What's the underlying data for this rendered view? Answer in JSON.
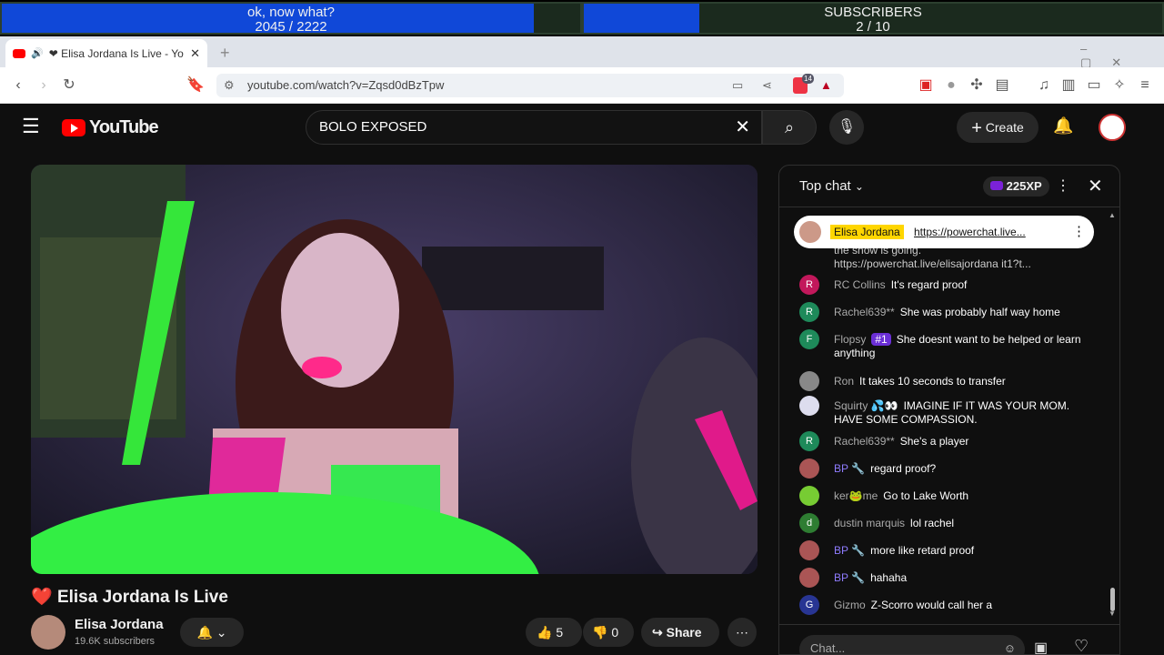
{
  "overlay": {
    "goal1": {
      "label": "ok, now what?",
      "current": "2045",
      "sep": "/",
      "total": "2222",
      "progress": 0.92
    },
    "goal2": {
      "label": "SUBSCRIBERS",
      "current": "2",
      "sep": "/",
      "total": "10",
      "progress": 0.2
    }
  },
  "browser": {
    "tab_title": "❤ Elisa Jordana Is Live - Yo",
    "url": "youtube.com/watch?v=Zqsd0dBzTpw",
    "brave_badge": "14"
  },
  "youtube": {
    "logo_text": "YouTube",
    "search_value": "BOLO EXPOSED",
    "create_label": "Create"
  },
  "video": {
    "title_heart": "❤️",
    "title": "Elisa Jordana Is Live",
    "channel": "Elisa Jordana",
    "subscribers": "19.6K subscribers",
    "likes": "5",
    "dislikes": "0",
    "share_label": "Share"
  },
  "chat": {
    "header": "Top chat",
    "xp": "225XP",
    "pinned": {
      "author": "Elisa Jordana",
      "text": "https://powerchat.live..."
    },
    "partial": "the show is going. https://powerchat.live/elisajordana it1?t...",
    "input_placeholder": "Chat...",
    "messages": [
      {
        "author": "RC Collins",
        "text": "It's regard proof",
        "avatar": "R",
        "color": "#c2185b"
      },
      {
        "author": "Rachel639**",
        "text": "She was probably half way home",
        "avatar": "R",
        "color": "#1e8a5a"
      },
      {
        "author": "Flopsy",
        "badge": "#1",
        "text": "She doesnt want to be helped or learn anything",
        "avatar": "F",
        "color": "#1e8a5a"
      },
      {
        "author": "Ron",
        "text": "It takes 10 seconds to transfer",
        "avatar": "",
        "color": "#888"
      },
      {
        "author": "Squirty 💦👀",
        "text": "IMAGINE IF IT WAS YOUR MOM. HAVE SOME COMPASSION.",
        "avatar": "",
        "color": "#dde"
      },
      {
        "author": "Rachel639**",
        "text": "She's a player",
        "avatar": "R",
        "color": "#1e8a5a"
      },
      {
        "author": "BP 🔧",
        "text": "regard proof?",
        "avatar": "",
        "color": "#a55",
        "mod": true
      },
      {
        "author": "ker🐸me",
        "text": "Go to Lake Worth",
        "avatar": "",
        "color": "#7c3"
      },
      {
        "author": "dustin marquis",
        "text": "lol rachel",
        "avatar": "d",
        "color": "#2e7d32"
      },
      {
        "author": "BP 🔧",
        "text": "more like retard proof",
        "avatar": "",
        "color": "#a55",
        "mod": true
      },
      {
        "author": "BP 🔧",
        "text": "hahaha",
        "avatar": "",
        "color": "#a55",
        "mod": true
      },
      {
        "author": "Gizmo",
        "text": "Z-Scorro would call her a",
        "avatar": "G",
        "color": "#283593"
      }
    ]
  }
}
